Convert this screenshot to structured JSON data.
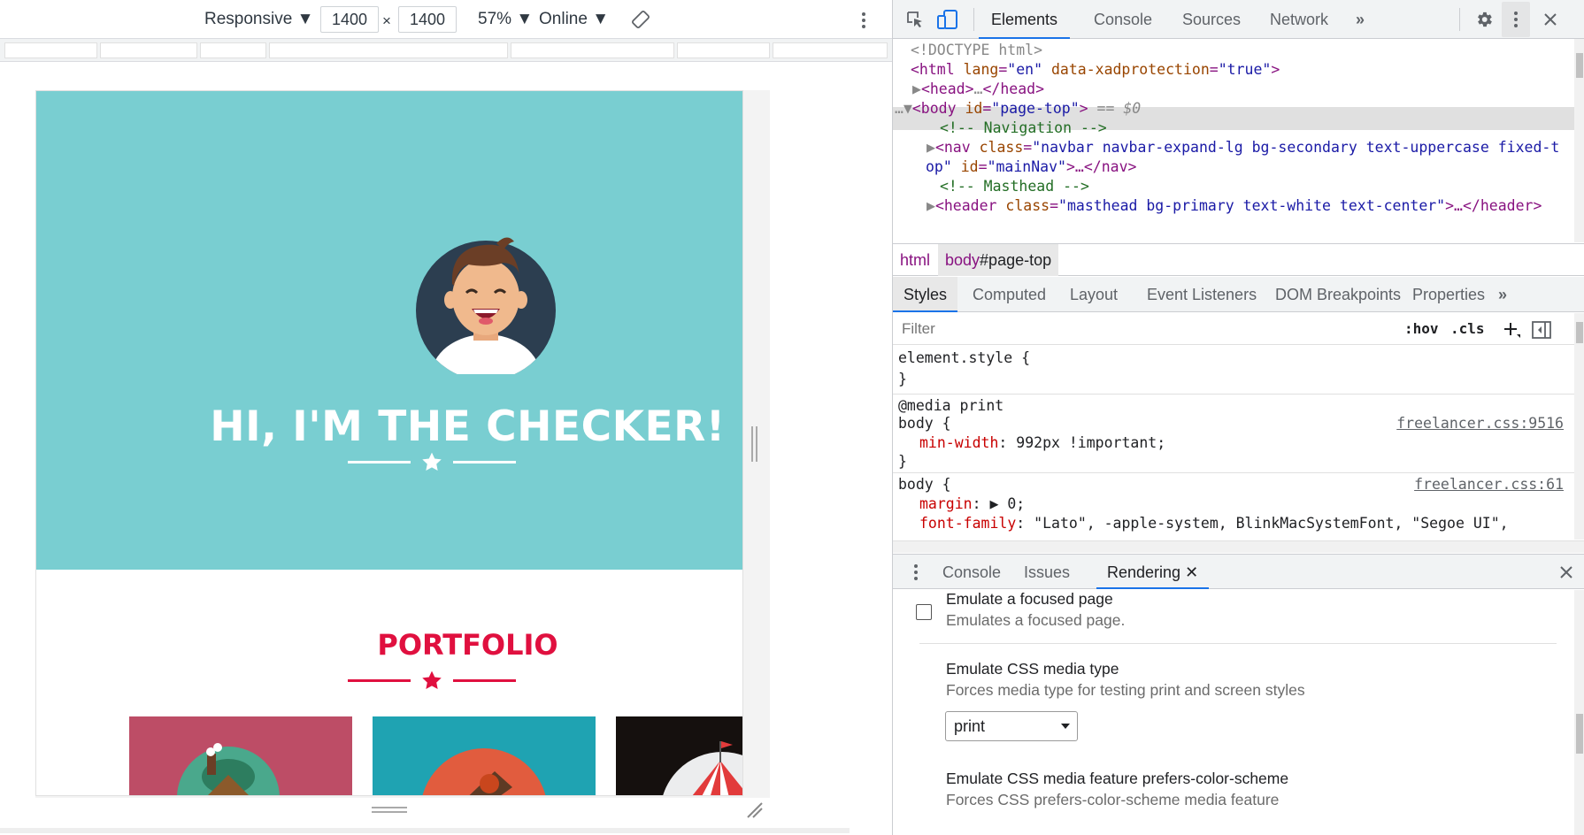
{
  "device_toolbar": {
    "device": "Responsive",
    "width": "1400",
    "times": "×",
    "height": "1400",
    "zoom": "57%",
    "throttle": "Online"
  },
  "page": {
    "hero_title": "HI, I'M THE CHECKER!",
    "portfolio_title": "PORTFOLIO",
    "colors": {
      "masthead": "#79ced1",
      "accent": "#e0103f",
      "card1": "#bd4d66",
      "card2": "#1fa3b2",
      "card3": "#15100e"
    }
  },
  "devtools": {
    "tabs": [
      "Elements",
      "Console",
      "Sources",
      "Network"
    ],
    "active_tab": "Elements",
    "dom": {
      "doctype": "<!DOCTYPE html>",
      "html_open": {
        "tag": "<html",
        "a1": " lang",
        "v1": "\"en\"",
        "a2": " data-xadprotection",
        "v2": "\"true\"",
        "end": ">"
      },
      "head": {
        "open": "<head>",
        "ellipsis": "…",
        "close": "</head>"
      },
      "body": {
        "tag": "<body",
        "a1": " id",
        "v1": "\"page-top\"",
        "end": ">",
        "eq": " == $0"
      },
      "comment_nav": "<!-- Navigation -->",
      "nav_line1": {
        "tag": "<nav",
        "a1": " class",
        "v1": "\"navbar navbar-expand-lg bg-secondary text-uppercase fixed-t"
      },
      "nav_line2": {
        "v1": "op\"",
        "a2": " id",
        "v2": "\"mainNav\"",
        "end": ">…</nav>"
      },
      "comment_masthead": "<!-- Masthead -->",
      "header": {
        "tag": "<header",
        "a1": " class",
        "v1": "\"masthead bg-primary text-white text-center\"",
        "end": ">…</header>"
      }
    },
    "breadcrumbs": [
      {
        "tag": "html",
        "id": ""
      },
      {
        "tag": "body",
        "id": "#page-top"
      }
    ],
    "styles_tabs": [
      "Styles",
      "Computed",
      "Layout",
      "Event Listeners",
      "DOM Breakpoints",
      "Properties"
    ],
    "filter_placeholder": "Filter",
    "hov": ":hov",
    "cls": ".cls",
    "rules": {
      "element_style": {
        "selector": "element.style {",
        "close": "}"
      },
      "print_rule": {
        "media": "@media print",
        "selector": "body {",
        "prop": "min-width",
        "value": ": 992px !important;",
        "close": "}",
        "source": "freelancer.css:9516"
      },
      "body_rule": {
        "selector": "body {",
        "prop1": "margin",
        "value1": ": ▶ 0;",
        "prop2": "font-family",
        "value2": ": \"Lato\", -apple-system, BlinkMacSystemFont, \"Segoe UI\",",
        "source": "freelancer.css:61"
      }
    },
    "drawer_tabs": [
      "Console",
      "Issues",
      "Rendering"
    ],
    "active_drawer_tab": "Rendering",
    "rendering": {
      "focused_title": "Emulate a focused page",
      "focused_desc": "Emulates a focused page.",
      "focused_checked": false,
      "media_title": "Emulate CSS media type",
      "media_desc": "Forces media type for testing print and screen styles",
      "media_value": "print",
      "scheme_title": "Emulate CSS media feature prefers-color-scheme",
      "scheme_desc": "Forces CSS prefers-color-scheme media feature"
    }
  }
}
